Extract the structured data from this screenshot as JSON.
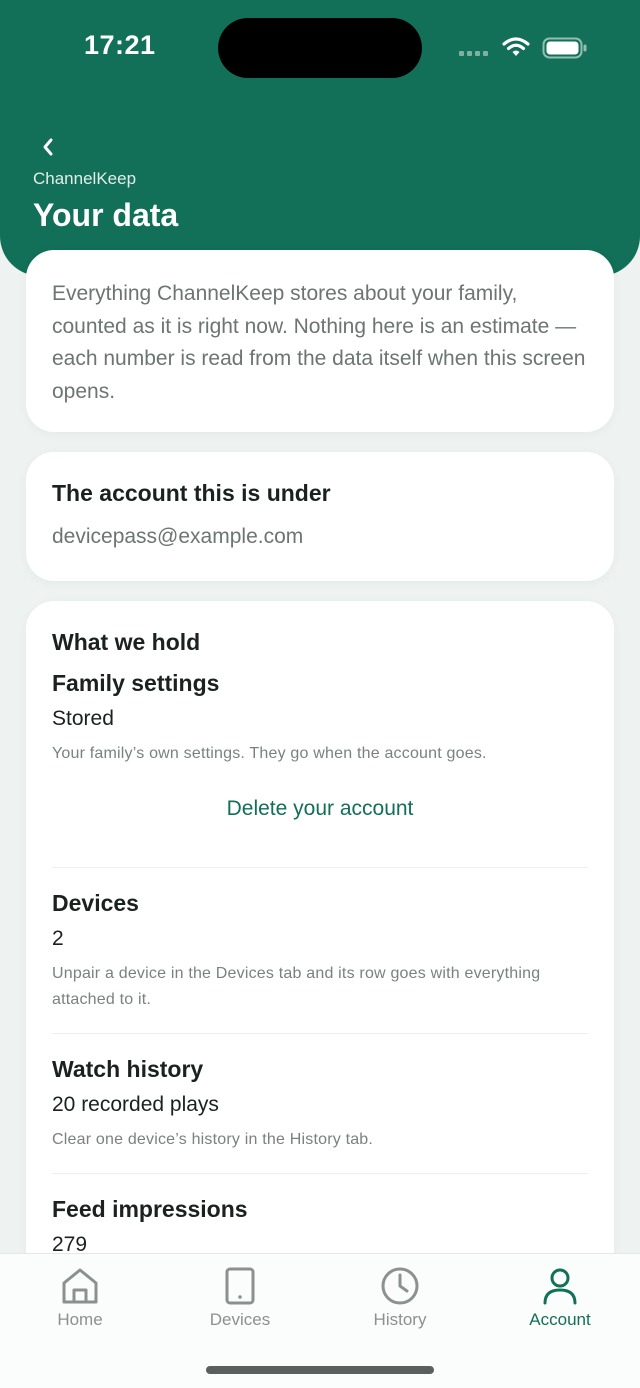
{
  "status_bar": {
    "time": "17:21"
  },
  "header": {
    "back_icon": "chevron-left-icon",
    "app_name": "ChannelKeep",
    "title": "Your data"
  },
  "intro": {
    "text": "Everything ChannelKeep stores about your family, counted as it is right now. Nothing here is an estimate — each number is read from the data itself when this screen opens."
  },
  "account": {
    "heading": "The account this is under",
    "email": "devicepass@example.com"
  },
  "holdings": {
    "heading": "What we hold",
    "family_settings": {
      "title": "Family settings",
      "value": "Stored",
      "note": "Your family’s own settings. They go when the account goes.",
      "delete_label": "Delete your account"
    },
    "devices": {
      "title": "Devices",
      "value": "2",
      "note": "Unpair a device in the Devices tab and its row goes with everything attached to it."
    },
    "watch_history": {
      "title": "Watch history",
      "value": "20 recorded plays",
      "note": "Clear one device’s history in the History tab."
    },
    "feed_impressions": {
      "title": "Feed impressions",
      "value": "279"
    }
  },
  "tabs": [
    {
      "label": "Home",
      "icon": "home-icon",
      "active": false
    },
    {
      "label": "Devices",
      "icon": "tablet-icon",
      "active": false
    },
    {
      "label": "History",
      "icon": "clock-icon",
      "active": false
    },
    {
      "label": "Account",
      "icon": "person-icon",
      "active": true
    }
  ],
  "colors": {
    "brand": "#126f58",
    "background": "#eef3f1",
    "muted_text": "#6d7471",
    "inactive_tab": "#8b918e"
  }
}
